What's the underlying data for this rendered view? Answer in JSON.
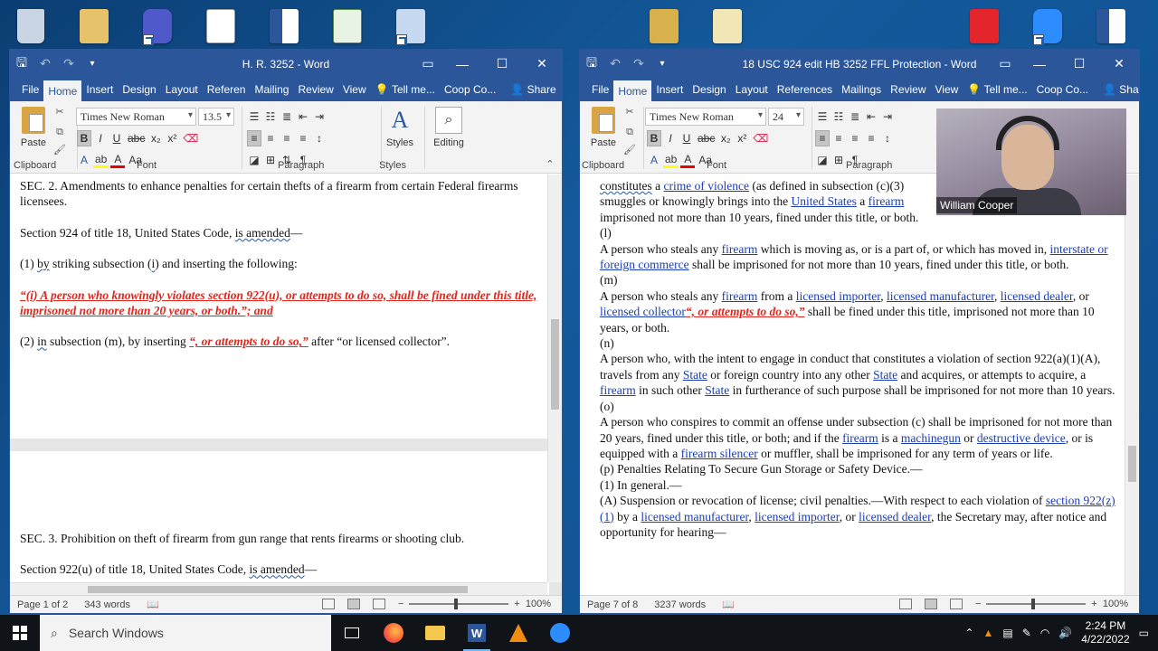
{
  "desktop": {
    "icons": [
      {
        "name": "recycle-bin",
        "color": "#c9d5e2"
      },
      {
        "name": "folder",
        "color": "#e6c26a"
      },
      {
        "name": "teams",
        "color": "#5059c9"
      },
      {
        "name": "word-doc",
        "color": "#ffffff"
      },
      {
        "name": "word",
        "color": "#2b579a"
      },
      {
        "name": "script",
        "color": "#e9f3e3"
      },
      {
        "name": "archive",
        "color": "#c6d9f0"
      },
      {
        "name": "zip-folder",
        "color": "#d8b04c"
      },
      {
        "name": "doc-folder",
        "color": "#f0e6b6"
      },
      {
        "name": "pdf",
        "color": "#e4252b"
      },
      {
        "name": "zoom",
        "color": "#2d8cff"
      },
      {
        "name": "word2",
        "color": "#2b579a"
      }
    ]
  },
  "left": {
    "title": "H. R. 3252 - Word",
    "tabs": [
      "File",
      "Home",
      "Insert",
      "Design",
      "Layout",
      "Referen",
      "Mailing",
      "Review",
      "View"
    ],
    "tell_me": "Tell me...",
    "user": "Coop Co...",
    "share": "Share",
    "font_name": "Times New Roman",
    "font_size": "13.5",
    "paste": "Paste",
    "styles": "Styles",
    "editing": "Editing",
    "groups": {
      "clipboard": "Clipboard",
      "font": "Font",
      "paragraph": "Paragraph",
      "styles": "Styles"
    },
    "doc": {
      "p1": "SEC. 2. Amendments to enhance penalties for certain thefts of a firearm from certain Federal firearms licensees.",
      "p2a": "Section 924 of title 18, United States Code, ",
      "p2b": "is amended",
      "p2c": "—",
      "p3a": "(1) ",
      "p3b": "by",
      "p3c": " striking subsection (",
      "p3d": "i",
      "p3e": ") and inserting the following:",
      "p4": "“(i) A person who knowingly violates section 922(u), or attempts to do so, shall be fined under this title, imprisoned not more than 20 years, or both.”; and",
      "p5a": "(2) ",
      "p5b": "in",
      "p5c": " subsection (m), by inserting ",
      "p5d": "“, or attempts to do so,”",
      "p5e": " after “or licensed collector”.",
      "p6": "SEC. 3. Prohibition on theft of firearm from gun range that rents firearms or shooting club.",
      "p7a": "Section 922(u) of title 18, United States Code, ",
      "p7b": "is amended",
      "p7c": "—"
    },
    "status": {
      "page": "Page 1 of 2",
      "words": "343 words",
      "zoom": "100%"
    }
  },
  "right": {
    "title": "18 USC 924 edit HB 3252 FFL Protection - Word",
    "tabs": [
      "File",
      "Home",
      "Insert",
      "Design",
      "Layout",
      "References",
      "Mailings",
      "Review",
      "View"
    ],
    "tell_me": "Tell me...",
    "user": "Coop Co...",
    "share": "Share",
    "font_name": "Times New Roman",
    "font_size": "24",
    "paste": "Paste",
    "groups": {
      "clipboard": "Clipboard",
      "font": "Font",
      "paragraph": "Paragraph"
    },
    "doc": {
      "l1a": "constitutes",
      "l1b": " a ",
      "l1c": "crime of violence",
      "l1d": " (as defined in subsection (c)(3)",
      "l2a": "smuggles or knowingly brings into the ",
      "l2b": "United States",
      "l2c": " a ",
      "l2d": "firearm",
      "l3": "imprisoned not more than 10 years, fined under this title, or both.",
      "sl": "(l)",
      "pl_a": "A person who steals any ",
      "pl_b": "firearm",
      "pl_c": " which is moving as, or is a part of, or which has moved in, ",
      "pl_d": "interstate or foreign commerce",
      "pl_e": " shall be imprisoned for not more than 10 years, fined under this title, or both.",
      "sm": "(m)",
      "pm_a": "A person who steals any ",
      "pm_b": "firearm",
      "pm_c": " from a ",
      "pm_d": "licensed importer",
      "pm_e": ", ",
      "pm_f": "licensed manufacturer",
      "pm_g": ", ",
      "pm_h": "licensed dealer",
      "pm_i": ", or ",
      "pm_j": "licensed collector",
      "pm_k": "“, or attempts to do so,”",
      "pm_l": "  shall be fined under this title, imprisoned not more than 10 years, or both.",
      "sn": "(n)",
      "pn_a": "A person who, with the intent to engage in conduct that constitutes a violation of section 922(a)(1)(A), travels from any ",
      "pn_b": "State",
      "pn_c": " or foreign country into any other ",
      "pn_d": "State",
      "pn_e": " and acquires, or attempts to acquire, a ",
      "pn_f": "firearm",
      "pn_g": " in such other ",
      "pn_h": "State",
      "pn_i": " in furtherance of such purpose shall be imprisoned for not more than 10 years.",
      "so": "(o)",
      "po_a": "A person who conspires to commit an offense under subsection (c) shall be imprisoned for not more than 20 years, fined under this title, or both; and if the ",
      "po_b": "firearm",
      "po_c": " is a ",
      "po_d": "machinegun",
      "po_e": " or ",
      "po_f": "destructive device",
      "po_g": ", or is equipped with a ",
      "po_h": "firearm silencer",
      "po_i": " or muffler, shall be imprisoned for any term of years or life.",
      "pp": "(p) Penalties Relating To Secure Gun Storage or Safety Device.—",
      "pp1": "(1) In general.—",
      "pa_a": "(A) Suspension or revocation of license; civil penalties.—With respect to each violation of ",
      "pa_b": "section 922(z)(1)",
      "pa_c": " by a ",
      "pa_d": "licensed manufacturer",
      "pa_e": ", ",
      "pa_f": "licensed importer",
      "pa_g": ", or ",
      "pa_h": "licensed dealer",
      "pa_i": ", the Secretary may, after notice and opportunity for hearing—"
    },
    "status": {
      "page": "Page 7 of 8",
      "words": "3237 words",
      "zoom": "100%"
    }
  },
  "webcam": {
    "label": "William Cooper"
  },
  "taskbar": {
    "search_placeholder": "Search Windows",
    "time": "2:24 PM",
    "date": "4/22/2022"
  }
}
